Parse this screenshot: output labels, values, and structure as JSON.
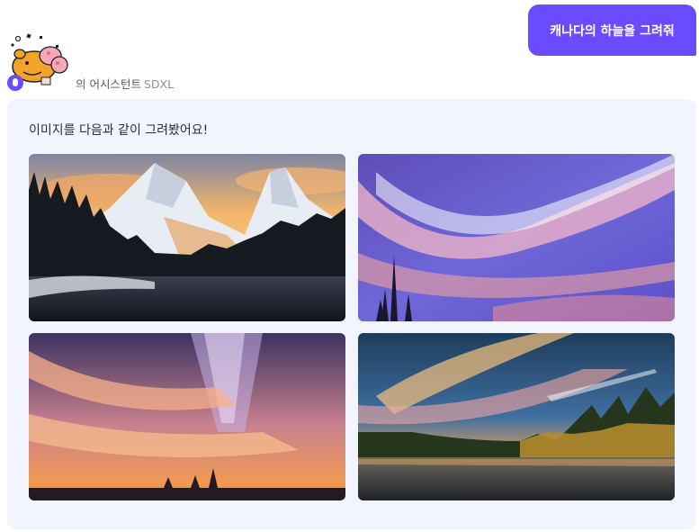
{
  "user_message": "캐나다의 하늘을 그려줘",
  "assistant": {
    "name_suffix": "의 어시스턴트",
    "model": "SDXL"
  },
  "response": {
    "text": "이미지를 다음과 같이 그려봤어요!",
    "images": [
      {
        "subject": "snowy mountain lake with pine forest at sunset"
      },
      {
        "subject": "violet sky with pink streaking clouds and pine silhouettes"
      },
      {
        "subject": "milky way over sunset clouds and city skyline"
      },
      {
        "subject": "sunset streak clouds over lake with autumn forest"
      }
    ]
  },
  "colors": {
    "accent": "#6b4bff",
    "card_bg": "#f2f5fd"
  }
}
